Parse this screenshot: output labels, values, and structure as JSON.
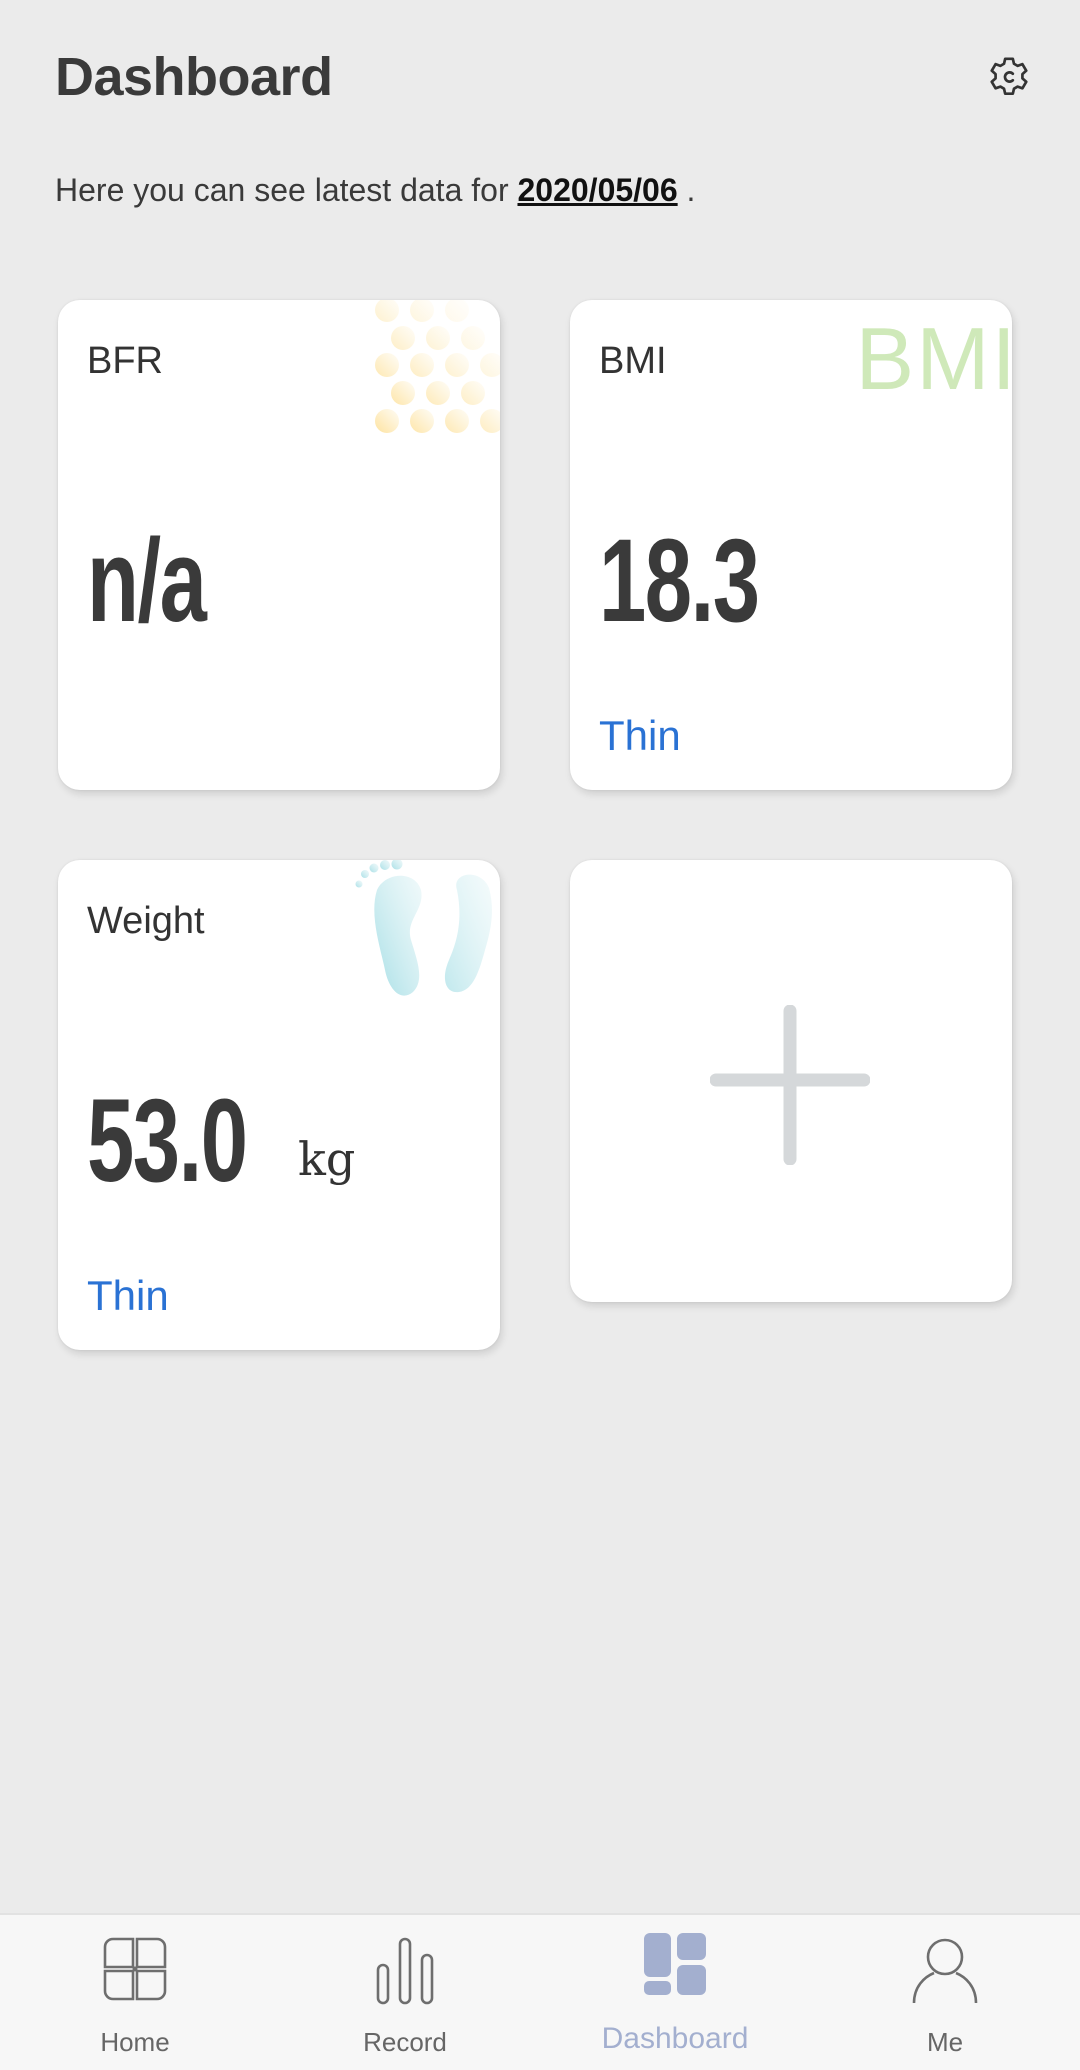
{
  "header": {
    "title": "Dashboard",
    "settings_icon": "gear-icon"
  },
  "subtitle": {
    "prefix": "Here you can see latest data for ",
    "date": "2020/05/06",
    "suffix": " ."
  },
  "cards": [
    {
      "label": "BFR",
      "value": "n/a",
      "unit": "",
      "status": "",
      "decoration": "dots-decoration"
    },
    {
      "label": "BMI",
      "value": "18.3",
      "unit": "",
      "status": "Thin",
      "decoration": "bmi-watermark",
      "watermark": "BMI"
    },
    {
      "label": "Weight",
      "value": "53.0",
      "unit": "kg",
      "status": "Thin",
      "decoration": "footprints-decoration"
    }
  ],
  "add_card": {
    "icon": "plus-icon"
  },
  "colors": {
    "background": "#ebebeb",
    "status_blue": "#2a72d4",
    "nav_active": "#a3afcf",
    "nav_inactive": "#666666"
  },
  "nav": {
    "items": [
      {
        "label": "Home",
        "icon": "home-grid-icon",
        "active": false
      },
      {
        "label": "Record",
        "icon": "bar-chart-icon",
        "active": false
      },
      {
        "label": "Dashboard",
        "icon": "dashboard-icon",
        "active": true
      },
      {
        "label": "Me",
        "icon": "person-icon",
        "active": false
      }
    ]
  }
}
